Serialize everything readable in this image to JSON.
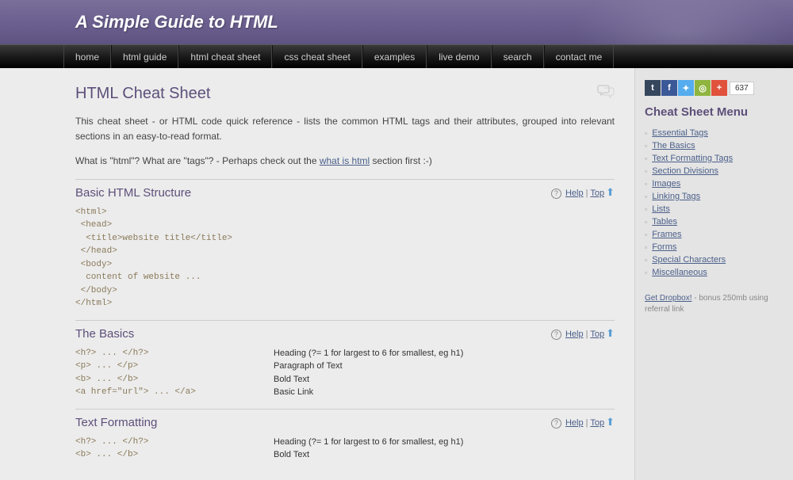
{
  "header": {
    "title": "A Simple Guide to HTML"
  },
  "nav": [
    "home",
    "html guide",
    "html cheat sheet",
    "css cheat sheet",
    "examples",
    "live demo",
    "search",
    "contact me"
  ],
  "page": {
    "title": "HTML Cheat Sheet",
    "intro1a": "This cheat sheet - or HTML code quick reference - lists the common HTML tags and their attributes, grouped into relevant sections in an easy-to-read format.",
    "intro2a": "What is \"html\"? What are \"tags\"? - Perhaps check out the ",
    "intro2link": "what is html",
    "intro2b": " section first :-)",
    "help": "Help",
    "top": "Top"
  },
  "sections": {
    "basic": {
      "title": "Basic HTML Structure",
      "code": "<html>\n <head>\n  <title>website title</title>\n </head>\n <body>\n  content of website ...\n </body>\n</html>"
    },
    "basics": {
      "title": "The Basics",
      "rows": [
        {
          "l": "<h?> ... </h?>",
          "r": "Heading (?= 1 for largest to 6 for smallest, eg h1)"
        },
        {
          "l": "<p> ... </p>",
          "r": "Paragraph of Text"
        },
        {
          "l": "<b> ... </b>",
          "r": "Bold Text"
        },
        {
          "l": "<a href=\"url\"> ... </a>",
          "r": "Basic Link"
        }
      ]
    },
    "textfmt": {
      "title": "Text Formatting",
      "rows": [
        {
          "l": "<h?> ... </h?>",
          "r": "Heading (?= 1 for largest to 6 for smallest, eg h1)"
        },
        {
          "l": "<b> ... </b>",
          "r": "Bold Text"
        }
      ]
    }
  },
  "sidebar": {
    "share_count": "637",
    "menu_title": "Cheat Sheet Menu",
    "menu": [
      "Essential Tags",
      "The Basics",
      "Text Formatting Tags",
      "Section Divisions",
      "Images",
      "Linking Tags",
      "Lists",
      "Tables",
      "Frames",
      "Forms",
      "Special Characters",
      "Miscellaneous"
    ],
    "dropbox_link": "Get Dropbox!",
    "dropbox_text": " - bonus 250mb using referral link"
  }
}
